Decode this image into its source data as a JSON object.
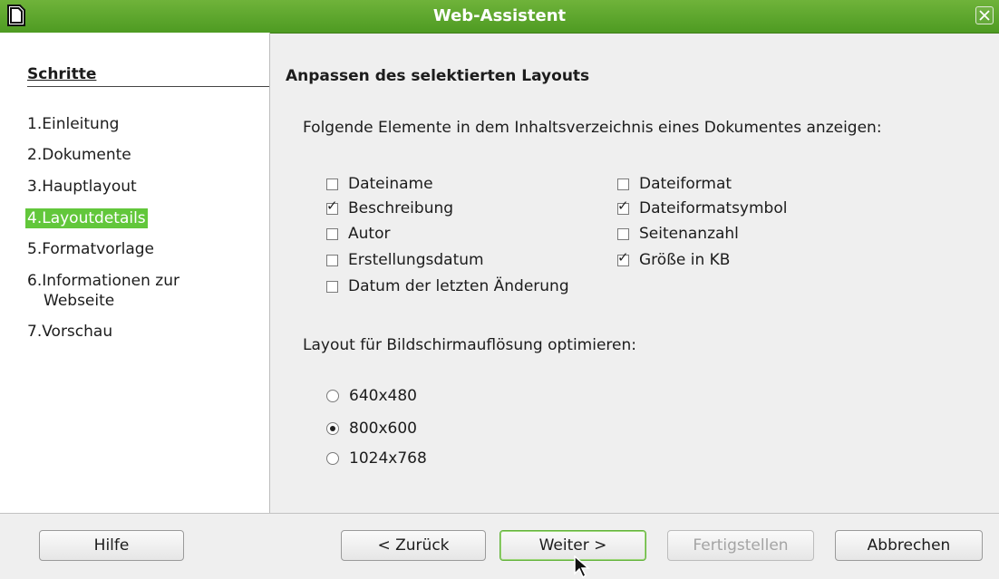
{
  "window": {
    "title": "Web-Assistent"
  },
  "steps": {
    "heading": "Schritte",
    "items": [
      {
        "num": "1.",
        "label": "Einleitung"
      },
      {
        "num": "2.",
        "label": "Dokumente"
      },
      {
        "num": "3.",
        "label": "Hauptlayout"
      },
      {
        "num": "4.",
        "label": "Layoutdetails"
      },
      {
        "num": "5.",
        "label": "Formatvorlage"
      },
      {
        "num": "6.",
        "label": "Informationen zur",
        "label2": "Webseite"
      },
      {
        "num": "7.",
        "label": "Vorschau"
      }
    ],
    "active_index": 3
  },
  "main": {
    "heading": "Anpassen des selektierten Layouts",
    "elements_label": "Folgende Elemente in dem Inhaltsverzeichnis eines Dokumentes anzeigen:",
    "checkboxes": [
      {
        "label": "Dateiname",
        "checked": false
      },
      {
        "label": "Beschreibung",
        "checked": true
      },
      {
        "label": "Autor",
        "checked": false
      },
      {
        "label": "Erstellungsdatum",
        "checked": false
      },
      {
        "label": "Datum der letzten Änderung",
        "checked": false
      },
      {
        "label": "Dateiformat",
        "checked": false
      },
      {
        "label": "Dateiformatsymbol",
        "checked": true
      },
      {
        "label": "Seitenanzahl",
        "checked": false
      },
      {
        "label": "Größe in KB",
        "checked": true
      }
    ],
    "resolution_label": "Layout für Bildschirmauflösung optimieren:",
    "resolutions": [
      {
        "label": "640x480",
        "selected": false
      },
      {
        "label": "800x600",
        "selected": true
      },
      {
        "label": "1024x768",
        "selected": false
      }
    ]
  },
  "buttons": {
    "help": "Hilfe",
    "back": "< Zurück",
    "next": "Weiter >",
    "finish": "Fertigstellen",
    "cancel": "Abbrechen"
  },
  "colors": {
    "titlebar": "#5aa52b",
    "active_step": "#62c73b"
  }
}
